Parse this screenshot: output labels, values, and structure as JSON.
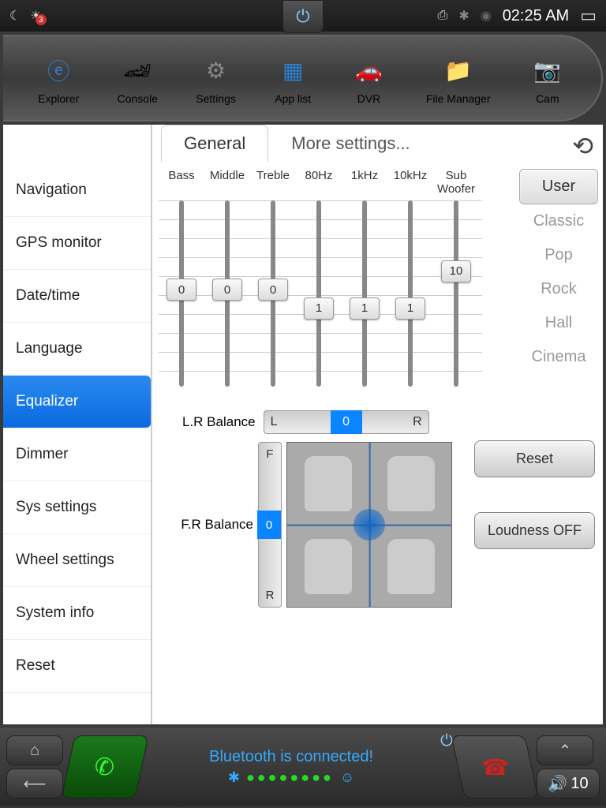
{
  "status": {
    "time": "02:25 AM",
    "badge": "3"
  },
  "dock": [
    {
      "label": "Explorer"
    },
    {
      "label": "Console"
    },
    {
      "label": "Settings"
    },
    {
      "label": "App list"
    },
    {
      "label": "DVR"
    },
    {
      "label": "File Manager"
    },
    {
      "label": "Cam"
    }
  ],
  "tabs": {
    "general": "General",
    "more": "More settings..."
  },
  "sidebar": [
    "Navigation",
    "GPS monitor",
    "Date/time",
    "Language",
    "Equalizer",
    "Dimmer",
    "Sys settings",
    "Wheel settings",
    "System info",
    "Reset"
  ],
  "sidebar_active": 4,
  "eq": {
    "bands": [
      "Bass",
      "Middle",
      "Treble",
      "80Hz",
      "1kHz",
      "10kHz",
      "Sub Woofer"
    ],
    "values": [
      0,
      0,
      0,
      1,
      1,
      1,
      10
    ],
    "positions": [
      48,
      48,
      48,
      58,
      58,
      58,
      38
    ]
  },
  "presets": [
    "User",
    "Classic",
    "Pop",
    "Rock",
    "Hall",
    "Cinema"
  ],
  "preset_active": 0,
  "balance": {
    "lr_label": "L.R Balance",
    "lr_left": "L",
    "lr_right": "R",
    "lr_value": "0",
    "fr_label": "F.R Balance",
    "fr_front": "F",
    "fr_rear": "R",
    "fr_value": "0"
  },
  "buttons": {
    "reset": "Reset",
    "loudness": "Loudness OFF"
  },
  "bottom": {
    "bt_status": "Bluetooth is connected!",
    "volume": "10"
  }
}
